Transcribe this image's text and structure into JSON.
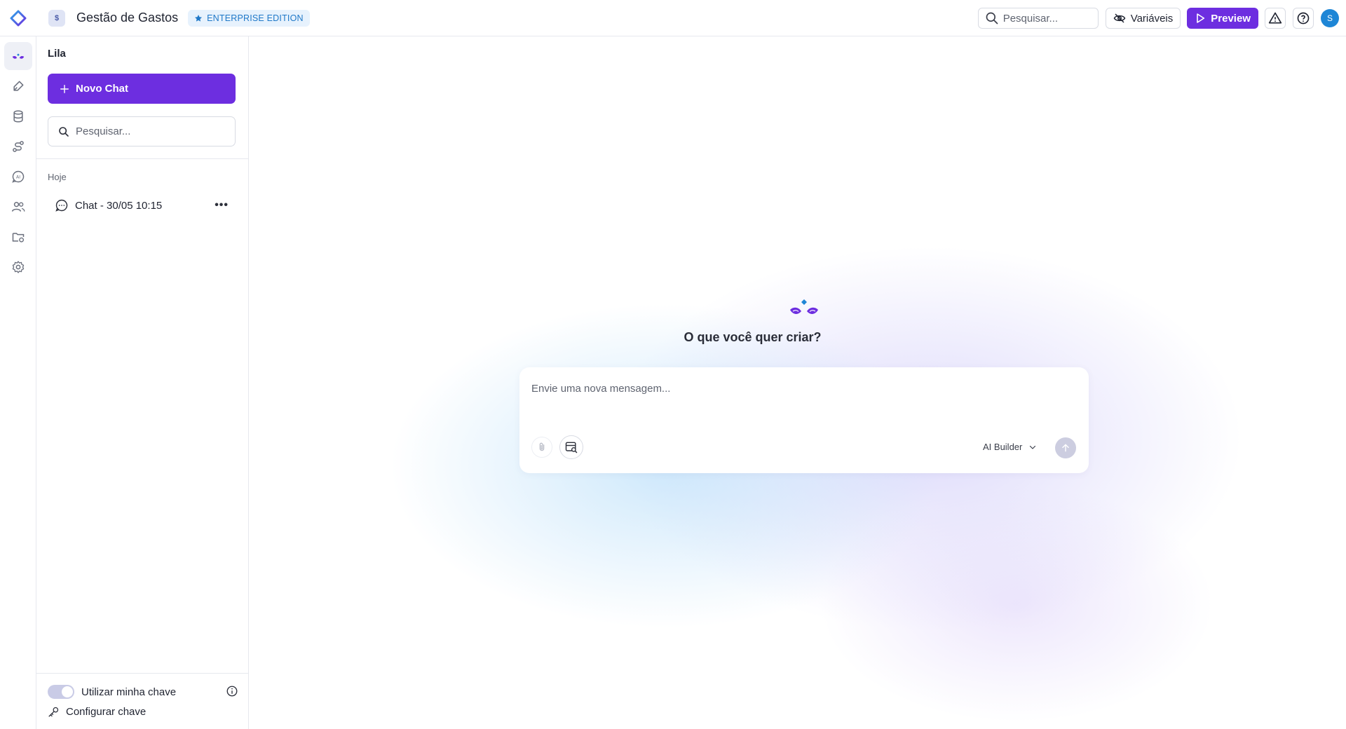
{
  "header": {
    "app_icon_label": "$",
    "app_title": "Gestão de Gastos",
    "edition_badge": "ENTERPRISE EDITION",
    "search_placeholder": "Pesquisar...",
    "variables_label": "Variáveis",
    "preview_label": "Preview",
    "avatar_initial": "S"
  },
  "rail": {
    "items": [
      "ai-assistant-icon",
      "brush-icon",
      "database-icon",
      "workflow-icon",
      "ai-chat-icon",
      "users-icon",
      "folder-settings-icon",
      "gear-icon"
    ],
    "active": "ai-assistant-icon"
  },
  "sidebar": {
    "title": "Lila",
    "new_chat_label": "Novo Chat",
    "search_placeholder": "Pesquisar...",
    "group_label": "Hoje",
    "chats": [
      {
        "title": "Chat - 30/05 10:15"
      }
    ],
    "toggle_label": "Utilizar minha chave",
    "config_label": "Configurar chave"
  },
  "main": {
    "hero_title": "O que você quer criar?",
    "composer_placeholder": "Envie uma nova mensagem...",
    "model_label": "AI Builder"
  },
  "colors": {
    "primary": "#6d2ee0",
    "edition_badge_text": "#1f78c8",
    "avatar": "#1e86d6",
    "send_disabled": "#cccde0"
  }
}
